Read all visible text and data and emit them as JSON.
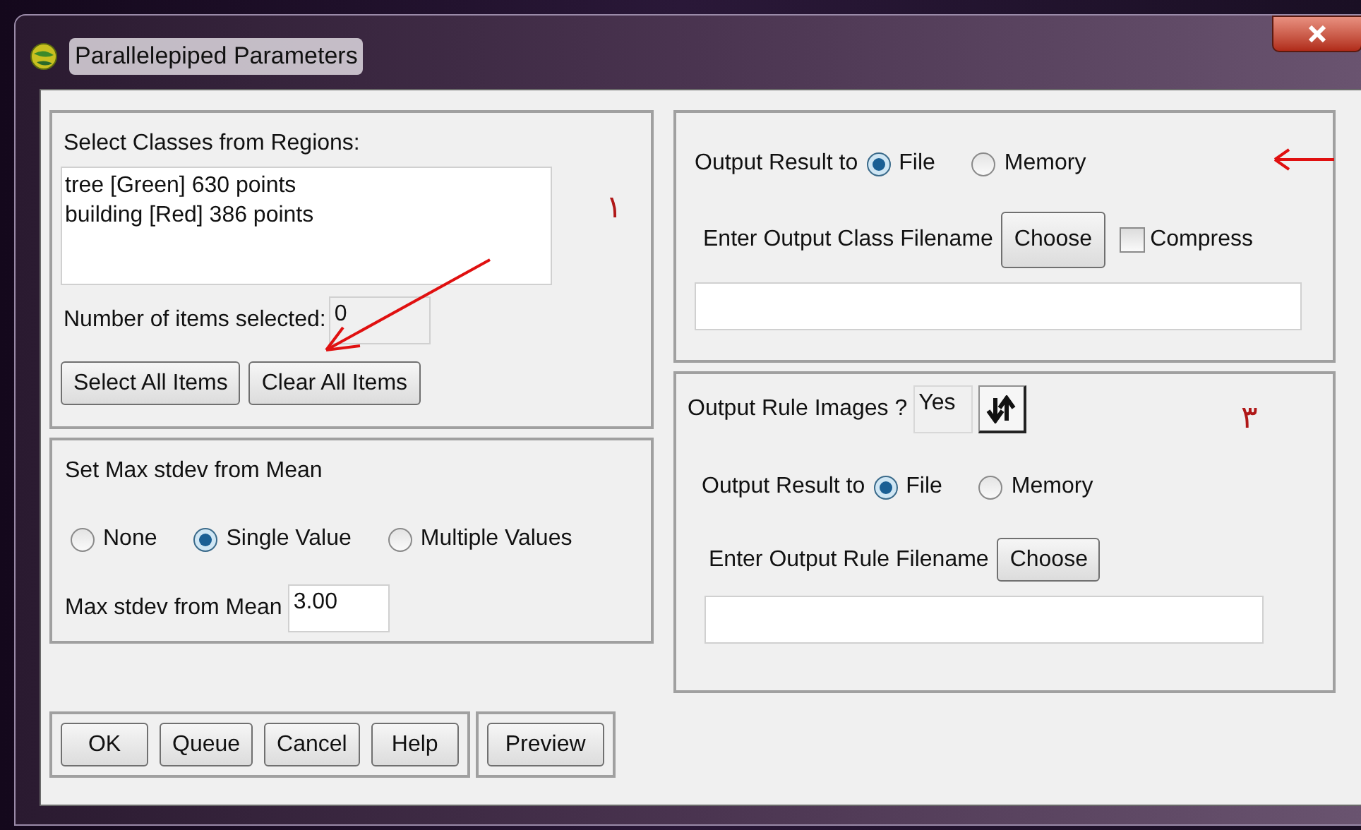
{
  "window": {
    "title": "Parallelepiped Parameters"
  },
  "classes_panel": {
    "label": "Select Classes from Regions:",
    "items": [
      "tree [Green] 630 points",
      "building [Red] 386 points"
    ],
    "count_label": "Number of items selected:",
    "count_value": "0",
    "buttons": [
      "Select All Items",
      "Clear All Items"
    ],
    "annotation": "١"
  },
  "stdev_panel": {
    "title": "Set Max stdev from Mean",
    "options": [
      {
        "label": "None",
        "selected": false
      },
      {
        "label": "Single Value",
        "selected": true
      },
      {
        "label": "Multiple Values",
        "selected": false
      }
    ],
    "field_label": "Max stdev from Mean",
    "field_value": "3.00"
  },
  "dialog_buttons": [
    "OK",
    "Queue",
    "Cancel",
    "Help"
  ],
  "preview_button": "Preview",
  "class_output_panel": {
    "output_label": "Output Result to",
    "options": [
      {
        "label": "File",
        "selected": true
      },
      {
        "label": "Memory",
        "selected": false
      }
    ],
    "filename_label": "Enter Output Class Filename",
    "choose_button": "Choose",
    "compress": {
      "label": "Compress",
      "checked": false
    }
  },
  "rule_output_panel": {
    "rule_images_label": "Output Rule Images ?",
    "rule_images_value": "Yes",
    "annotation": "٣",
    "output_label": "Output Result to",
    "options": [
      {
        "label": "File",
        "selected": true
      },
      {
        "label": "Memory",
        "selected": false
      }
    ],
    "filename_label": "Enter Output Rule Filename",
    "choose_button": "Choose"
  }
}
